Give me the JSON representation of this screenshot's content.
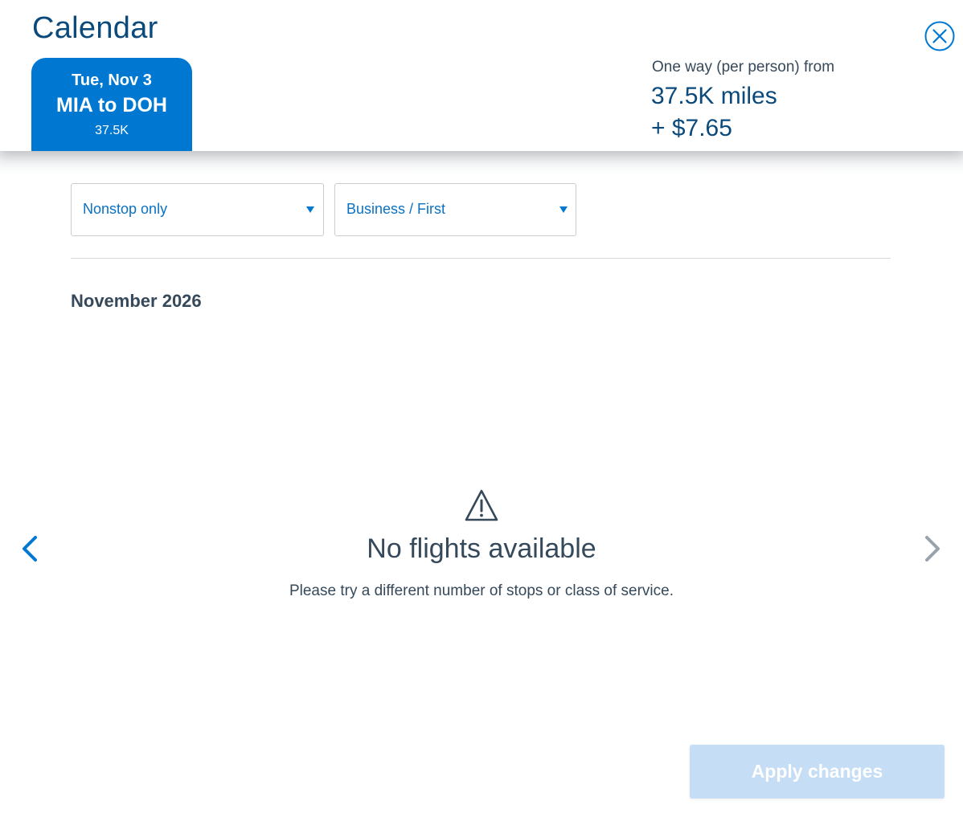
{
  "header": {
    "title": "Calendar",
    "close_icon": "close-circle-icon"
  },
  "selected_tab": {
    "date": "Tue, Nov 3",
    "route": "MIA to DOH",
    "miles": "37.5K"
  },
  "fare": {
    "label": "One way (per person) from",
    "miles": "37.5K miles",
    "cash": "+ $7.65"
  },
  "filters": {
    "stops": {
      "selected": "Nonstop only",
      "icon": "chevron-down-icon"
    },
    "cabin": {
      "selected": "Business / First",
      "icon": "chevron-down-icon"
    }
  },
  "calendar": {
    "month": "November 2026"
  },
  "empty_state": {
    "icon": "warning-icon",
    "title": "No flights available",
    "message": "Please try a different number of stops or class of service."
  },
  "navigation": {
    "prev_icon": "chevron-left-icon",
    "next_icon": "chevron-right-icon"
  },
  "footer": {
    "apply_label": "Apply changes"
  },
  "colors": {
    "brand_blue": "#0078d2",
    "title_navy": "#0b4a7a",
    "text_slate": "#36495a",
    "apply_disabled": "#c5ddf5"
  }
}
